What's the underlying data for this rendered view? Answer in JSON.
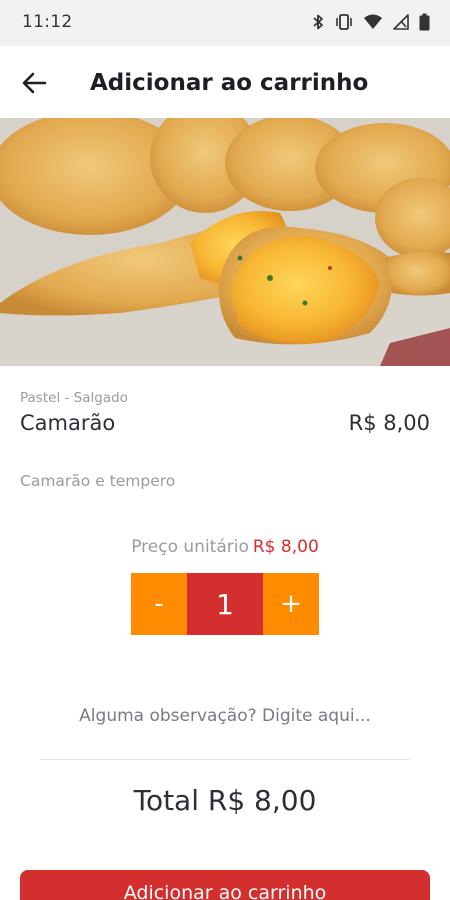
{
  "status_bar": {
    "time": "11:12",
    "icons": [
      "bluetooth-icon",
      "vibrate-icon",
      "wifi-icon",
      "signal-icon",
      "battery-icon"
    ]
  },
  "app_bar": {
    "back_icon": "arrow-left-icon",
    "title": "Adicionar ao carrinho"
  },
  "product": {
    "category": "Pastel - Salgado",
    "name": "Camarão",
    "price": "R$ 8,00",
    "description": "Camarão e tempero",
    "image_alt": "pastel-photo"
  },
  "unit_price": {
    "label": "Preço unitário",
    "value": "R$ 8,00"
  },
  "stepper": {
    "minus_label": "-",
    "quantity": "1",
    "plus_label": "+"
  },
  "observation": {
    "placeholder": "Alguma observação? Digite aqui..."
  },
  "total": {
    "text": "Total R$ 8,00"
  },
  "add_button": {
    "label": "Adicionar ao carrinho"
  },
  "colors": {
    "accent_orange": "#ff8c00",
    "accent_red": "#d32f2f",
    "price_red": "#d92b2b",
    "muted_text": "#9a9aa6"
  }
}
